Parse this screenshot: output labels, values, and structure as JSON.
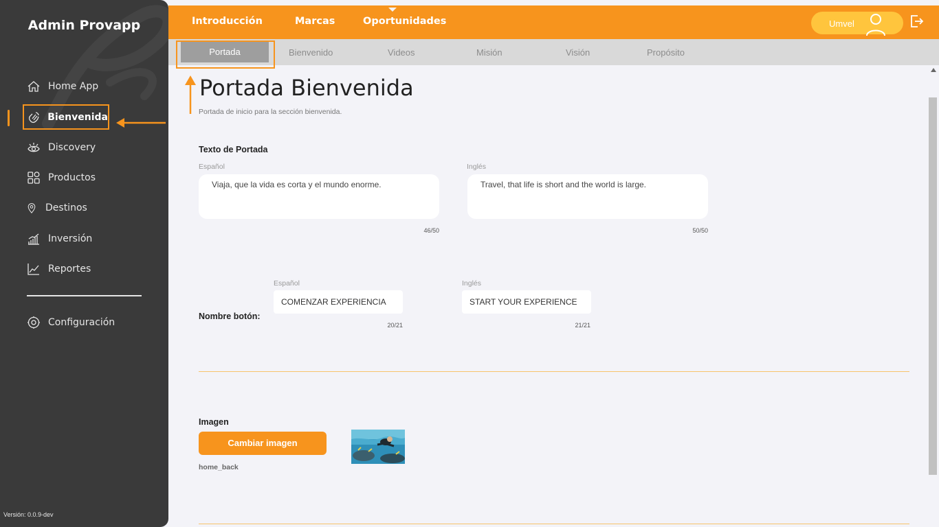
{
  "sidebar": {
    "app_title": "Admin Provapp",
    "items": [
      {
        "label": "Home App",
        "icon": "home-icon"
      },
      {
        "label": "Bienvenida",
        "icon": "wave-hand-icon"
      },
      {
        "label": "Discovery",
        "icon": "eye-icon"
      },
      {
        "label": "Productos",
        "icon": "grid-icon"
      },
      {
        "label": "Destinos",
        "icon": "location-pin-icon"
      },
      {
        "label": "Inversión",
        "icon": "bar-chart-icon"
      },
      {
        "label": "Reportes",
        "icon": "line-chart-icon"
      }
    ],
    "settings_label": "Configuración",
    "version": "Versión: 0.0.9-dev"
  },
  "topbar": {
    "tabs": [
      "Introducción",
      "Marcas",
      "Oportunidades"
    ],
    "user_name": "Umvel"
  },
  "subtabs": [
    "Portada",
    "Bienvenido",
    "Videos",
    "Misión",
    "Visión",
    "Propósito"
  ],
  "main": {
    "title": "Portada Bienvenida",
    "subtitle": "Portada de inicio para la sección bienvenida.",
    "cover_text": {
      "label": "Texto de Portada",
      "es_label": "Español",
      "es_value": "Viaja, que la vida es corta y el mundo enorme.",
      "es_counter": "46/50",
      "en_label": "Inglés",
      "en_value": "Travel, that life is short and the world is large.",
      "en_counter": "50/50"
    },
    "button_name": {
      "label": "Nombre botón:",
      "es_label": "Español",
      "es_value": "COMENZAR EXPERIENCIA",
      "es_counter": "20/21",
      "en_label": "Inglés",
      "en_value": "START YOUR EXPERIENCE",
      "en_counter": "21/21"
    },
    "image": {
      "label": "Imagen",
      "change_button": "Cambiar imagen",
      "filename": "home_back"
    }
  },
  "colors": {
    "accent": "#f7941d",
    "sidebar_bg": "#3a3a3a",
    "user_pill": "#ffc53d",
    "content_bg": "#f3f3f8"
  }
}
